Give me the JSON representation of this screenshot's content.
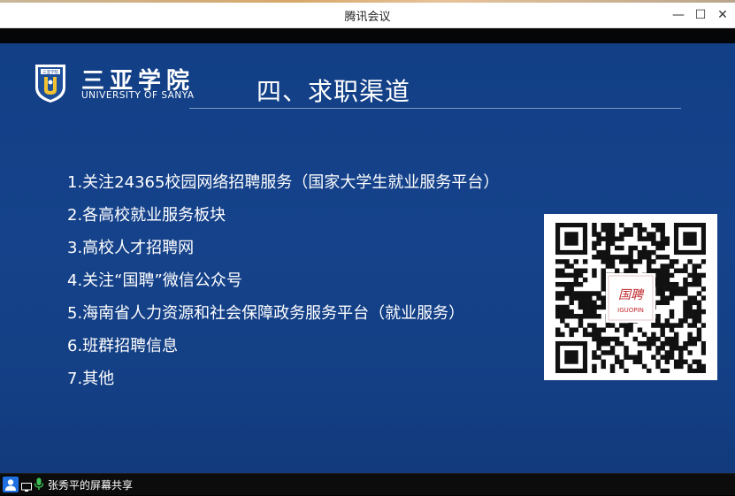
{
  "window": {
    "title": "腾讯会议",
    "minimize_glyph": "—",
    "maximize_glyph": "☐",
    "close_glyph": "✕"
  },
  "slide": {
    "brand_cn": "三亚学院",
    "brand_en": "UNIVERSITY OF SANYA",
    "title": "四、求职渠道",
    "items": [
      "1.关注24365校园网络招聘服务（国家大学生就业服务平台）",
      "2.各高校就业服务板块",
      "3.高校人才招聘网",
      "4.关注“国聘”微信公众号",
      "5.海南省人力资源和社会保障政务服务平台（就业服务）",
      "6.班群招聘信息",
      "7.其他"
    ],
    "qr_center_text": "国聘",
    "qr_center_sub": "IGUOPIN",
    "logo_text": "三亚学院"
  },
  "footer": {
    "share_label": "张秀平的屏幕共享",
    "icons": [
      "user-icon",
      "screen-share-icon",
      "microphone-icon"
    ]
  },
  "colors": {
    "slide_bg": "#143f86",
    "accent_blue": "#1f6fe0",
    "qr_red": "#c0282d"
  }
}
